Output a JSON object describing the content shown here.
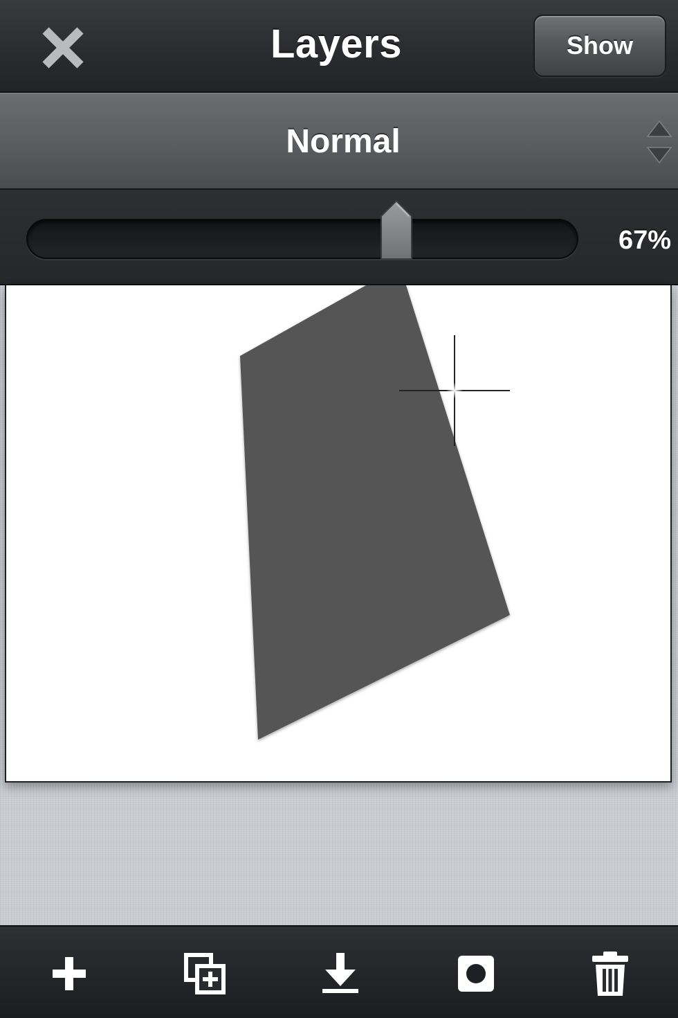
{
  "header": {
    "title": "Layers",
    "show_label": "Show",
    "close_icon": "close-x-icon"
  },
  "blend": {
    "mode": "Normal",
    "stepper_icon": "up-down-arrows-icon"
  },
  "opacity": {
    "value": 0.67,
    "label": "67%"
  },
  "canvas": {
    "shape_color": "#555555",
    "background": "#ffffff"
  },
  "toolbar": {
    "items": [
      {
        "name": "add-layer",
        "icon": "plus-icon"
      },
      {
        "name": "duplicate-layer",
        "icon": "duplicate-icon"
      },
      {
        "name": "merge-down",
        "icon": "download-arrow-icon"
      },
      {
        "name": "layer-mask",
        "icon": "mask-icon"
      },
      {
        "name": "delete-layer",
        "icon": "trash-icon"
      }
    ]
  },
  "colors": {
    "bar_dark": "#2b2c2f",
    "blend_bar": "#5b5d61",
    "text": "#ffffff",
    "icon_gray": "#bfc0c2"
  }
}
